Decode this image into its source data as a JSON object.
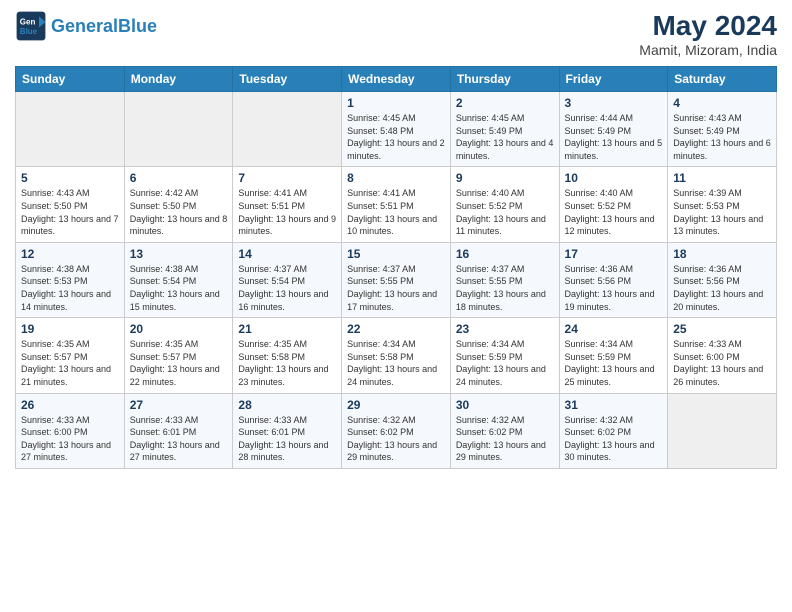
{
  "header": {
    "logo_general": "General",
    "logo_blue": "Blue",
    "title": "May 2024",
    "subtitle": "Mamit, Mizoram, India"
  },
  "calendar": {
    "days_of_week": [
      "Sunday",
      "Monday",
      "Tuesday",
      "Wednesday",
      "Thursday",
      "Friday",
      "Saturday"
    ],
    "weeks": [
      [
        {
          "day": "",
          "sunrise": "",
          "sunset": "",
          "daylight": ""
        },
        {
          "day": "",
          "sunrise": "",
          "sunset": "",
          "daylight": ""
        },
        {
          "day": "",
          "sunrise": "",
          "sunset": "",
          "daylight": ""
        },
        {
          "day": "1",
          "sunrise": "Sunrise: 4:45 AM",
          "sunset": "Sunset: 5:48 PM",
          "daylight": "Daylight: 13 hours and 2 minutes."
        },
        {
          "day": "2",
          "sunrise": "Sunrise: 4:45 AM",
          "sunset": "Sunset: 5:49 PM",
          "daylight": "Daylight: 13 hours and 4 minutes."
        },
        {
          "day": "3",
          "sunrise": "Sunrise: 4:44 AM",
          "sunset": "Sunset: 5:49 PM",
          "daylight": "Daylight: 13 hours and 5 minutes."
        },
        {
          "day": "4",
          "sunrise": "Sunrise: 4:43 AM",
          "sunset": "Sunset: 5:49 PM",
          "daylight": "Daylight: 13 hours and 6 minutes."
        }
      ],
      [
        {
          "day": "5",
          "sunrise": "Sunrise: 4:43 AM",
          "sunset": "Sunset: 5:50 PM",
          "daylight": "Daylight: 13 hours and 7 minutes."
        },
        {
          "day": "6",
          "sunrise": "Sunrise: 4:42 AM",
          "sunset": "Sunset: 5:50 PM",
          "daylight": "Daylight: 13 hours and 8 minutes."
        },
        {
          "day": "7",
          "sunrise": "Sunrise: 4:41 AM",
          "sunset": "Sunset: 5:51 PM",
          "daylight": "Daylight: 13 hours and 9 minutes."
        },
        {
          "day": "8",
          "sunrise": "Sunrise: 4:41 AM",
          "sunset": "Sunset: 5:51 PM",
          "daylight": "Daylight: 13 hours and 10 minutes."
        },
        {
          "day": "9",
          "sunrise": "Sunrise: 4:40 AM",
          "sunset": "Sunset: 5:52 PM",
          "daylight": "Daylight: 13 hours and 11 minutes."
        },
        {
          "day": "10",
          "sunrise": "Sunrise: 4:40 AM",
          "sunset": "Sunset: 5:52 PM",
          "daylight": "Daylight: 13 hours and 12 minutes."
        },
        {
          "day": "11",
          "sunrise": "Sunrise: 4:39 AM",
          "sunset": "Sunset: 5:53 PM",
          "daylight": "Daylight: 13 hours and 13 minutes."
        }
      ],
      [
        {
          "day": "12",
          "sunrise": "Sunrise: 4:38 AM",
          "sunset": "Sunset: 5:53 PM",
          "daylight": "Daylight: 13 hours and 14 minutes."
        },
        {
          "day": "13",
          "sunrise": "Sunrise: 4:38 AM",
          "sunset": "Sunset: 5:54 PM",
          "daylight": "Daylight: 13 hours and 15 minutes."
        },
        {
          "day": "14",
          "sunrise": "Sunrise: 4:37 AM",
          "sunset": "Sunset: 5:54 PM",
          "daylight": "Daylight: 13 hours and 16 minutes."
        },
        {
          "day": "15",
          "sunrise": "Sunrise: 4:37 AM",
          "sunset": "Sunset: 5:55 PM",
          "daylight": "Daylight: 13 hours and 17 minutes."
        },
        {
          "day": "16",
          "sunrise": "Sunrise: 4:37 AM",
          "sunset": "Sunset: 5:55 PM",
          "daylight": "Daylight: 13 hours and 18 minutes."
        },
        {
          "day": "17",
          "sunrise": "Sunrise: 4:36 AM",
          "sunset": "Sunset: 5:56 PM",
          "daylight": "Daylight: 13 hours and 19 minutes."
        },
        {
          "day": "18",
          "sunrise": "Sunrise: 4:36 AM",
          "sunset": "Sunset: 5:56 PM",
          "daylight": "Daylight: 13 hours and 20 minutes."
        }
      ],
      [
        {
          "day": "19",
          "sunrise": "Sunrise: 4:35 AM",
          "sunset": "Sunset: 5:57 PM",
          "daylight": "Daylight: 13 hours and 21 minutes."
        },
        {
          "day": "20",
          "sunrise": "Sunrise: 4:35 AM",
          "sunset": "Sunset: 5:57 PM",
          "daylight": "Daylight: 13 hours and 22 minutes."
        },
        {
          "day": "21",
          "sunrise": "Sunrise: 4:35 AM",
          "sunset": "Sunset: 5:58 PM",
          "daylight": "Daylight: 13 hours and 23 minutes."
        },
        {
          "day": "22",
          "sunrise": "Sunrise: 4:34 AM",
          "sunset": "Sunset: 5:58 PM",
          "daylight": "Daylight: 13 hours and 24 minutes."
        },
        {
          "day": "23",
          "sunrise": "Sunrise: 4:34 AM",
          "sunset": "Sunset: 5:59 PM",
          "daylight": "Daylight: 13 hours and 24 minutes."
        },
        {
          "day": "24",
          "sunrise": "Sunrise: 4:34 AM",
          "sunset": "Sunset: 5:59 PM",
          "daylight": "Daylight: 13 hours and 25 minutes."
        },
        {
          "day": "25",
          "sunrise": "Sunrise: 4:33 AM",
          "sunset": "Sunset: 6:00 PM",
          "daylight": "Daylight: 13 hours and 26 minutes."
        }
      ],
      [
        {
          "day": "26",
          "sunrise": "Sunrise: 4:33 AM",
          "sunset": "Sunset: 6:00 PM",
          "daylight": "Daylight: 13 hours and 27 minutes."
        },
        {
          "day": "27",
          "sunrise": "Sunrise: 4:33 AM",
          "sunset": "Sunset: 6:01 PM",
          "daylight": "Daylight: 13 hours and 27 minutes."
        },
        {
          "day": "28",
          "sunrise": "Sunrise: 4:33 AM",
          "sunset": "Sunset: 6:01 PM",
          "daylight": "Daylight: 13 hours and 28 minutes."
        },
        {
          "day": "29",
          "sunrise": "Sunrise: 4:32 AM",
          "sunset": "Sunset: 6:02 PM",
          "daylight": "Daylight: 13 hours and 29 minutes."
        },
        {
          "day": "30",
          "sunrise": "Sunrise: 4:32 AM",
          "sunset": "Sunset: 6:02 PM",
          "daylight": "Daylight: 13 hours and 29 minutes."
        },
        {
          "day": "31",
          "sunrise": "Sunrise: 4:32 AM",
          "sunset": "Sunset: 6:02 PM",
          "daylight": "Daylight: 13 hours and 30 minutes."
        },
        {
          "day": "",
          "sunrise": "",
          "sunset": "",
          "daylight": ""
        }
      ]
    ]
  }
}
